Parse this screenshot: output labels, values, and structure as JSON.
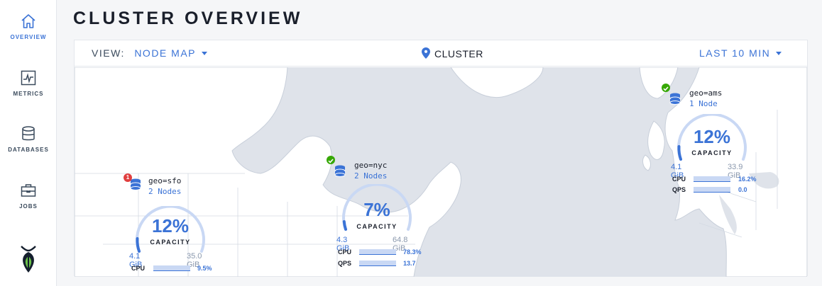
{
  "sidebar": {
    "items": [
      {
        "label": "OVERVIEW",
        "icon": "home-icon"
      },
      {
        "label": "METRICS",
        "icon": "metrics-icon"
      },
      {
        "label": "DATABASES",
        "icon": "database-icon"
      },
      {
        "label": "JOBS",
        "icon": "briefcase-icon"
      }
    ],
    "logo": "cockroach-logo"
  },
  "header": {
    "title": "CLUSTER OVERVIEW"
  },
  "toolbar": {
    "view_label": "VIEW:",
    "view_value": "NODE MAP",
    "cluster_label": "CLUSTER",
    "time_range": "LAST 10 MIN"
  },
  "colors": {
    "accent": "#3b73d6",
    "ok": "#37a806",
    "error": "#e03f3f",
    "map_land": "#ffffff",
    "map_water": "#dfe3ea"
  },
  "localities": [
    {
      "name": "geo=sfo",
      "nodes": "2 Nodes",
      "status": "error",
      "alert_count": "1",
      "capacity_pct": "12%",
      "capacity_label": "CAPACITY",
      "used": "4.1 GiB",
      "total": "35.0 GiB",
      "capacity_fraction": 0.12,
      "stats": [
        {
          "label": "CPU",
          "value": "9.5%"
        }
      ]
    },
    {
      "name": "geo=nyc",
      "nodes": "2 Nodes",
      "status": "ok",
      "capacity_pct": "7%",
      "capacity_label": "CAPACITY",
      "used": "4.3 GiB",
      "total": "64.8 GiB",
      "capacity_fraction": 0.07,
      "stats": [
        {
          "label": "CPU",
          "value": "78.3%"
        },
        {
          "label": "QPS",
          "value": "13.7"
        }
      ]
    },
    {
      "name": "geo=ams",
      "nodes": "1 Node",
      "status": "ok",
      "capacity_pct": "12%",
      "capacity_label": "CAPACITY",
      "used": "4.1 GiB",
      "total": "33.9 GiB",
      "capacity_fraction": 0.12,
      "stats": [
        {
          "label": "CPU",
          "value": "16.2%"
        },
        {
          "label": "QPS",
          "value": "0.0"
        }
      ]
    }
  ]
}
